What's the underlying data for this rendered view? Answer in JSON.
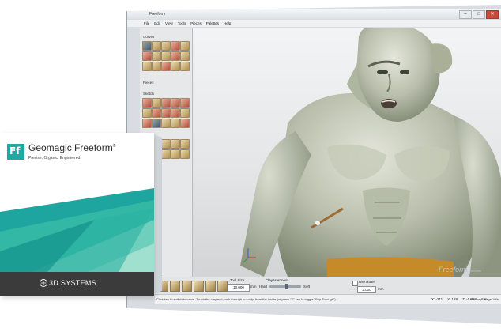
{
  "app": {
    "title": "Freeform",
    "menu": [
      "File",
      "Edit",
      "View",
      "Tools",
      "Pieces",
      "Palettes",
      "Help"
    ],
    "window_buttons": [
      "–",
      "□",
      "✕"
    ]
  },
  "left_panel": {
    "sections": [
      "Curves",
      "Pieces",
      "Sketch"
    ]
  },
  "bottom_toolbar": {
    "tool_size_label": "Tool Size",
    "tool_size_value": "10.000",
    "tool_size_unit": "mm",
    "clay_hardness_label": "Clay Hardness",
    "clay_hard_label": "Hard",
    "clay_soft_label": "Soft",
    "clay_hardness_level": 0.55,
    "use_ruler_label": "Use Ruler",
    "ruler_value": "2.000",
    "ruler_unit": "mm"
  },
  "status_bar": {
    "hint": "Click key to switch to carve. Touch the clay and push through to sculpt from the inside (or press \"T\" key to toggle \"Pop Through\").",
    "x": "X: -211",
    "y": "Y: 128",
    "z": "Z: -0.882",
    "unit": "mm",
    "memory": "Memory Usage 10%",
    "memory_fraction": 0.1
  },
  "viewport": {
    "watermark": "Freeform",
    "watermark_sub": "Innovate"
  },
  "box": {
    "logo_letters": "Ff",
    "product_name": "Geomagic Freeform",
    "trademark": "®",
    "tagline": "Precise. Organic. Engineered.",
    "brand": "3D SYSTEMS",
    "accent": "#20a8a2"
  }
}
